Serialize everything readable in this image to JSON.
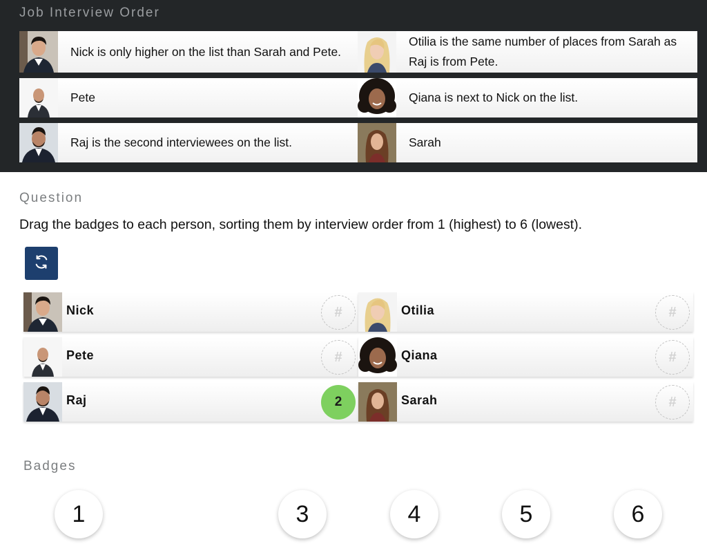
{
  "header": {
    "title": "Job Interview Order",
    "clues": [
      {
        "left": {
          "person": "nick",
          "text": "Nick is only higher on the list than Sarah and Pete."
        },
        "right": {
          "person": "otilia",
          "text": "Otilia is the same number of places from Sarah as Raj is from Pete."
        }
      },
      {
        "left": {
          "person": "pete",
          "text": "Pete"
        },
        "right": {
          "person": "qiana",
          "text": "Qiana is next to Nick on the list."
        }
      },
      {
        "left": {
          "person": "raj",
          "text": "Raj is the second interviewees on the list."
        },
        "right": {
          "person": "sarah",
          "text": "Sarah"
        }
      }
    ]
  },
  "question": {
    "label": "Question",
    "text": "Drag the badges to each person, sorting them by interview order from 1 (highest) to 6 (lowest).",
    "reset_icon": "refresh-icon"
  },
  "people": [
    {
      "name": "Nick",
      "slot": "#"
    },
    {
      "name": "Otilia",
      "slot": "#"
    },
    {
      "name": "Pete",
      "slot": "#"
    },
    {
      "name": "Qiana",
      "slot": "#"
    },
    {
      "name": "Raj",
      "slot": "2"
    },
    {
      "name": "Sarah",
      "slot": "#"
    }
  ],
  "badges": {
    "label": "Badges",
    "items": [
      "1",
      "3",
      "4",
      "5",
      "6"
    ]
  },
  "colors": {
    "header_bg": "#232628",
    "reset_button": "#1d3f6e",
    "filled_slot": "#7ed05f"
  }
}
